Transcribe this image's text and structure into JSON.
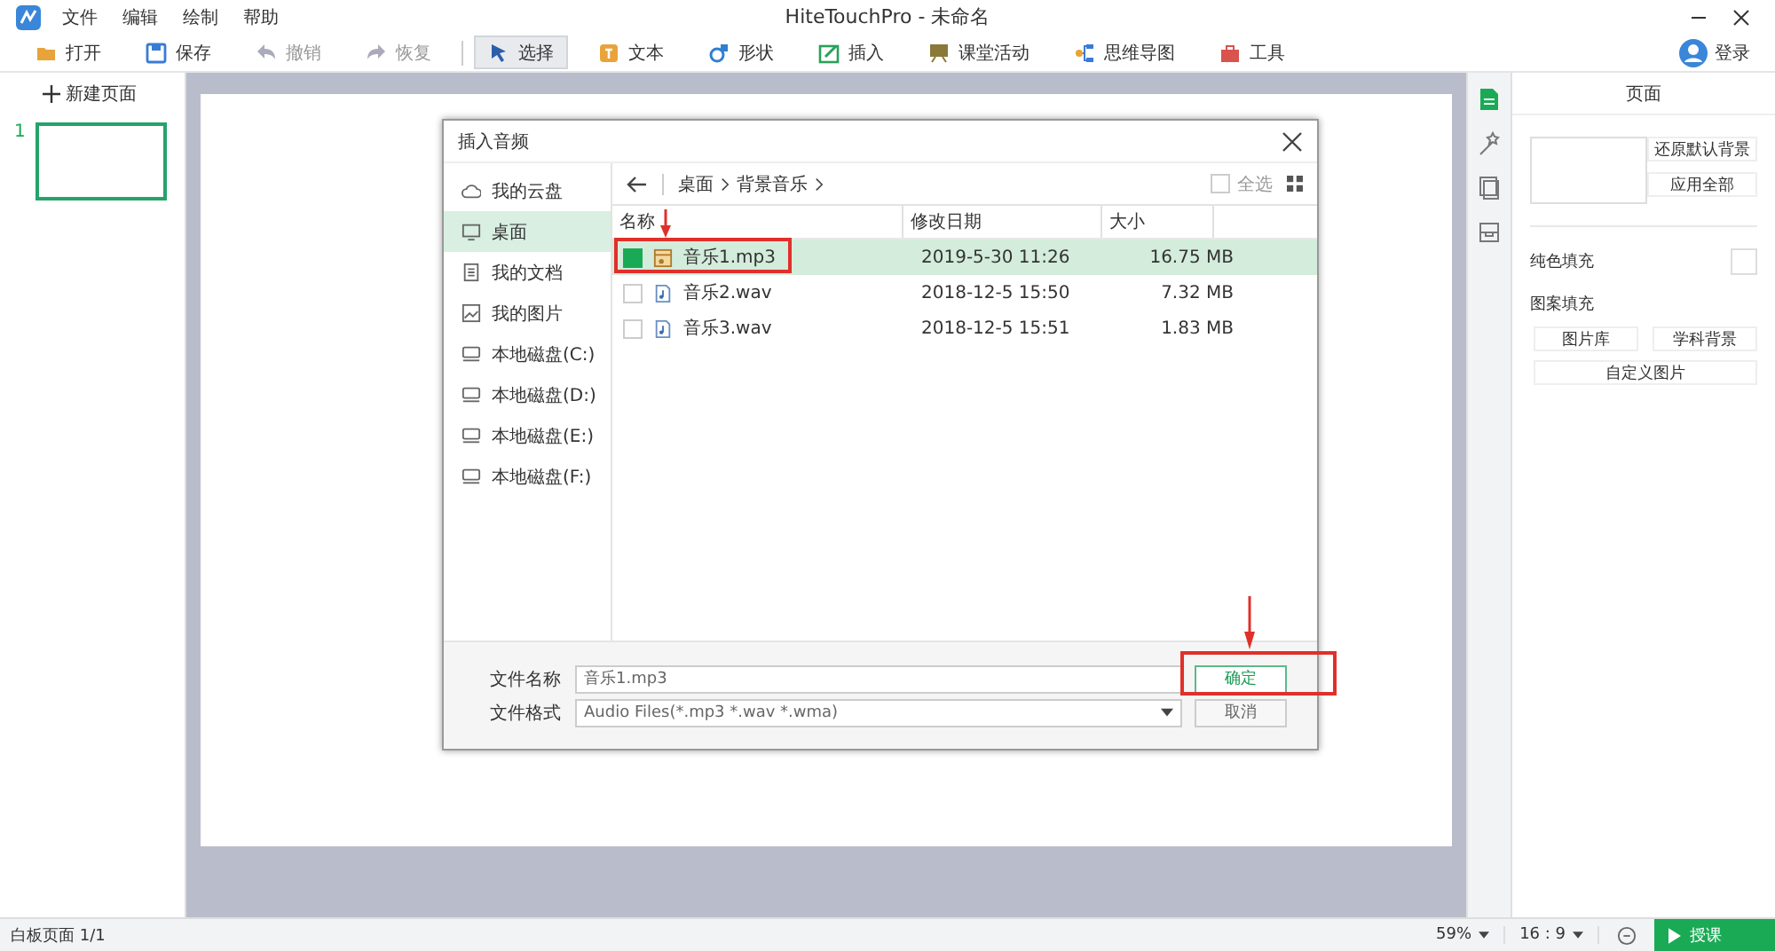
{
  "app": {
    "title": "HiteTouchPro - 未命名",
    "menu": [
      "文件",
      "编辑",
      "绘制",
      "帮助"
    ],
    "login": "登录"
  },
  "toolbar": [
    {
      "label": "打开",
      "disabled": false,
      "selected": false
    },
    {
      "label": "保存",
      "disabled": false,
      "selected": false
    },
    {
      "label": "撤销",
      "disabled": true,
      "selected": false
    },
    {
      "label": "恢复",
      "disabled": true,
      "selected": false
    },
    {
      "label": "选择",
      "disabled": false,
      "selected": true
    },
    {
      "label": "文本",
      "disabled": false,
      "selected": false
    },
    {
      "label": "形状",
      "disabled": false,
      "selected": false
    },
    {
      "label": "插入",
      "disabled": false,
      "selected": false
    },
    {
      "label": "课堂活动",
      "disabled": false,
      "selected": false
    },
    {
      "label": "思维导图",
      "disabled": false,
      "selected": false
    },
    {
      "label": "工具",
      "disabled": false,
      "selected": false
    }
  ],
  "pages": {
    "new_page": "新建页面",
    "items": [
      {
        "number": "1",
        "selected": true
      }
    ]
  },
  "dialog": {
    "title": "插入音频",
    "places": [
      {
        "label": "我的云盘",
        "kind": "cloud",
        "selected": false
      },
      {
        "label": "桌面",
        "kind": "desktop",
        "selected": true
      },
      {
        "label": "我的文档",
        "kind": "document",
        "selected": false
      },
      {
        "label": "我的图片",
        "kind": "image",
        "selected": false
      },
      {
        "label": "本地磁盘(C:)",
        "kind": "disk",
        "selected": false
      },
      {
        "label": "本地磁盘(D:)",
        "kind": "disk",
        "selected": false
      },
      {
        "label": "本地磁盘(E:)",
        "kind": "disk",
        "selected": false
      },
      {
        "label": "本地磁盘(F:)",
        "kind": "disk",
        "selected": false
      }
    ],
    "breadcrumb": [
      "桌面",
      "背景音乐"
    ],
    "select_all": {
      "label": "全选",
      "checked": false
    },
    "columns": [
      "名称",
      "修改日期",
      "大小"
    ],
    "files": [
      {
        "name": "音乐1.mp3",
        "kind": "mp3",
        "date": "2019-5-30 11:26",
        "size": "16.75 MB",
        "selected": true
      },
      {
        "name": "音乐2.wav",
        "kind": "wav",
        "date": "2018-12-5 15:50",
        "size": "7.32 MB",
        "selected": false
      },
      {
        "name": "音乐3.wav",
        "kind": "wav",
        "date": "2018-12-5 15:51",
        "size": "1.83 MB",
        "selected": false
      }
    ],
    "filename": {
      "label": "文件名称",
      "value": "音乐1.mp3"
    },
    "filetype": {
      "label": "文件格式",
      "value": "Audio Files(*.mp3 *.wav *.wma)"
    },
    "buttons": [
      "确定",
      "取消"
    ]
  },
  "right_panel": {
    "title": "页面",
    "restore": "还原默认背景",
    "apply_all": "应用全部",
    "solid_fill": "纯色填充",
    "pattern_fill": "图案填充",
    "pattern_buttons": [
      "图片库",
      "学科背景",
      "自定义图片"
    ]
  },
  "status": {
    "page": "白板页面 1/1",
    "zoom": "59%",
    "ratio": "16 : 9",
    "start": "授课"
  }
}
